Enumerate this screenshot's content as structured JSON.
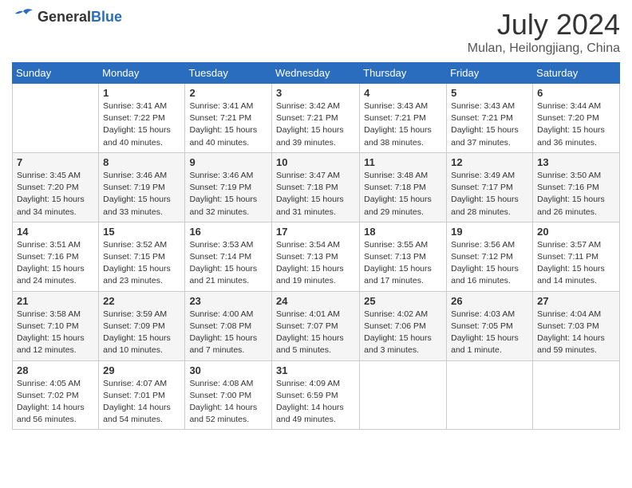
{
  "header": {
    "logo_general": "General",
    "logo_blue": "Blue",
    "title": "July 2024",
    "subtitle": "Mulan, Heilongjiang, China"
  },
  "columns": [
    "Sunday",
    "Monday",
    "Tuesday",
    "Wednesday",
    "Thursday",
    "Friday",
    "Saturday"
  ],
  "weeks": [
    {
      "days": [
        {
          "num": "",
          "info": ""
        },
        {
          "num": "1",
          "info": "Sunrise: 3:41 AM\nSunset: 7:22 PM\nDaylight: 15 hours\nand 40 minutes."
        },
        {
          "num": "2",
          "info": "Sunrise: 3:41 AM\nSunset: 7:21 PM\nDaylight: 15 hours\nand 40 minutes."
        },
        {
          "num": "3",
          "info": "Sunrise: 3:42 AM\nSunset: 7:21 PM\nDaylight: 15 hours\nand 39 minutes."
        },
        {
          "num": "4",
          "info": "Sunrise: 3:43 AM\nSunset: 7:21 PM\nDaylight: 15 hours\nand 38 minutes."
        },
        {
          "num": "5",
          "info": "Sunrise: 3:43 AM\nSunset: 7:21 PM\nDaylight: 15 hours\nand 37 minutes."
        },
        {
          "num": "6",
          "info": "Sunrise: 3:44 AM\nSunset: 7:20 PM\nDaylight: 15 hours\nand 36 minutes."
        }
      ]
    },
    {
      "days": [
        {
          "num": "7",
          "info": "Sunrise: 3:45 AM\nSunset: 7:20 PM\nDaylight: 15 hours\nand 34 minutes."
        },
        {
          "num": "8",
          "info": "Sunrise: 3:46 AM\nSunset: 7:19 PM\nDaylight: 15 hours\nand 33 minutes."
        },
        {
          "num": "9",
          "info": "Sunrise: 3:46 AM\nSunset: 7:19 PM\nDaylight: 15 hours\nand 32 minutes."
        },
        {
          "num": "10",
          "info": "Sunrise: 3:47 AM\nSunset: 7:18 PM\nDaylight: 15 hours\nand 31 minutes."
        },
        {
          "num": "11",
          "info": "Sunrise: 3:48 AM\nSunset: 7:18 PM\nDaylight: 15 hours\nand 29 minutes."
        },
        {
          "num": "12",
          "info": "Sunrise: 3:49 AM\nSunset: 7:17 PM\nDaylight: 15 hours\nand 28 minutes."
        },
        {
          "num": "13",
          "info": "Sunrise: 3:50 AM\nSunset: 7:16 PM\nDaylight: 15 hours\nand 26 minutes."
        }
      ]
    },
    {
      "days": [
        {
          "num": "14",
          "info": "Sunrise: 3:51 AM\nSunset: 7:16 PM\nDaylight: 15 hours\nand 24 minutes."
        },
        {
          "num": "15",
          "info": "Sunrise: 3:52 AM\nSunset: 7:15 PM\nDaylight: 15 hours\nand 23 minutes."
        },
        {
          "num": "16",
          "info": "Sunrise: 3:53 AM\nSunset: 7:14 PM\nDaylight: 15 hours\nand 21 minutes."
        },
        {
          "num": "17",
          "info": "Sunrise: 3:54 AM\nSunset: 7:13 PM\nDaylight: 15 hours\nand 19 minutes."
        },
        {
          "num": "18",
          "info": "Sunrise: 3:55 AM\nSunset: 7:13 PM\nDaylight: 15 hours\nand 17 minutes."
        },
        {
          "num": "19",
          "info": "Sunrise: 3:56 AM\nSunset: 7:12 PM\nDaylight: 15 hours\nand 16 minutes."
        },
        {
          "num": "20",
          "info": "Sunrise: 3:57 AM\nSunset: 7:11 PM\nDaylight: 15 hours\nand 14 minutes."
        }
      ]
    },
    {
      "days": [
        {
          "num": "21",
          "info": "Sunrise: 3:58 AM\nSunset: 7:10 PM\nDaylight: 15 hours\nand 12 minutes."
        },
        {
          "num": "22",
          "info": "Sunrise: 3:59 AM\nSunset: 7:09 PM\nDaylight: 15 hours\nand 10 minutes."
        },
        {
          "num": "23",
          "info": "Sunrise: 4:00 AM\nSunset: 7:08 PM\nDaylight: 15 hours\nand 7 minutes."
        },
        {
          "num": "24",
          "info": "Sunrise: 4:01 AM\nSunset: 7:07 PM\nDaylight: 15 hours\nand 5 minutes."
        },
        {
          "num": "25",
          "info": "Sunrise: 4:02 AM\nSunset: 7:06 PM\nDaylight: 15 hours\nand 3 minutes."
        },
        {
          "num": "26",
          "info": "Sunrise: 4:03 AM\nSunset: 7:05 PM\nDaylight: 15 hours\nand 1 minute."
        },
        {
          "num": "27",
          "info": "Sunrise: 4:04 AM\nSunset: 7:03 PM\nDaylight: 14 hours\nand 59 minutes."
        }
      ]
    },
    {
      "days": [
        {
          "num": "28",
          "info": "Sunrise: 4:05 AM\nSunset: 7:02 PM\nDaylight: 14 hours\nand 56 minutes."
        },
        {
          "num": "29",
          "info": "Sunrise: 4:07 AM\nSunset: 7:01 PM\nDaylight: 14 hours\nand 54 minutes."
        },
        {
          "num": "30",
          "info": "Sunrise: 4:08 AM\nSunset: 7:00 PM\nDaylight: 14 hours\nand 52 minutes."
        },
        {
          "num": "31",
          "info": "Sunrise: 4:09 AM\nSunset: 6:59 PM\nDaylight: 14 hours\nand 49 minutes."
        },
        {
          "num": "",
          "info": ""
        },
        {
          "num": "",
          "info": ""
        },
        {
          "num": "",
          "info": ""
        }
      ]
    }
  ]
}
